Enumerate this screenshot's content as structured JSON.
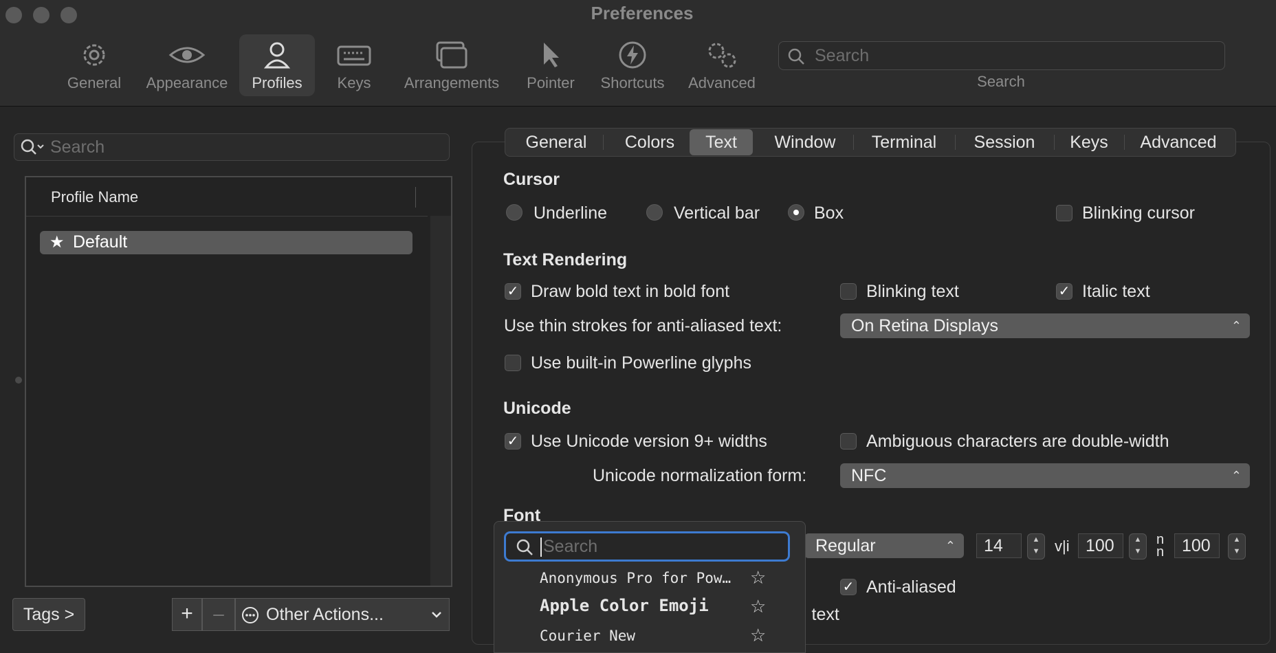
{
  "window": {
    "title": "Preferences"
  },
  "toolbar": {
    "items": [
      {
        "label": "General",
        "icon": "gear-icon"
      },
      {
        "label": "Appearance",
        "icon": "eye-icon"
      },
      {
        "label": "Profiles",
        "icon": "person-icon",
        "active": true
      },
      {
        "label": "Keys",
        "icon": "keyboard-icon"
      },
      {
        "label": "Arrangements",
        "icon": "window-stack-icon"
      },
      {
        "label": "Pointer",
        "icon": "pointer-icon"
      },
      {
        "label": "Shortcuts",
        "icon": "bolt-icon"
      },
      {
        "label": "Advanced",
        "icon": "gears-icon"
      }
    ],
    "search_placeholder": "Search",
    "search_label": "Search"
  },
  "profiles": {
    "search_placeholder": "Search",
    "column_header": "Profile Name",
    "items": [
      {
        "name": "Default",
        "is_default": true
      }
    ],
    "tags_button": "Tags >",
    "add_button": "+",
    "remove_button": "–",
    "other_actions": "Other Actions..."
  },
  "tabs": {
    "items": [
      "General",
      "Colors",
      "Text",
      "Window",
      "Terminal",
      "Session",
      "Keys",
      "Advanced"
    ],
    "active": "Text"
  },
  "cursor": {
    "heading": "Cursor",
    "options": [
      "Underline",
      "Vertical bar",
      "Box"
    ],
    "selected": "Box",
    "blinking_label": "Blinking cursor",
    "blinking": false
  },
  "text_rendering": {
    "heading": "Text Rendering",
    "bold_label": "Draw bold text in bold font",
    "bold": true,
    "blinking_label": "Blinking text",
    "blinking": false,
    "italic_label": "Italic text",
    "italic": true,
    "thin_strokes_label": "Use thin strokes for anti-aliased text:",
    "thin_strokes_value": "On Retina Displays",
    "powerline_label": "Use built-in Powerline glyphs",
    "powerline": false
  },
  "unicode": {
    "heading": "Unicode",
    "widths_label": "Use Unicode version 9+ widths",
    "widths": true,
    "ambiguous_label": "Ambiguous characters are double-width",
    "ambiguous": false,
    "normalization_label": "Unicode normalization form:",
    "normalization_value": "NFC"
  },
  "font": {
    "heading": "Font",
    "style_value": "Regular",
    "size_value": "14",
    "vspacing_value": "100",
    "hspacing_value": "100",
    "antialiased_label": "Anti-aliased",
    "antialiased": true,
    "partial_label": "l text"
  },
  "font_popover": {
    "search_placeholder": "Search",
    "fonts": [
      "Anonymous Pro for Pow…",
      "Apple  Color  Emoji",
      "Courier New"
    ]
  }
}
